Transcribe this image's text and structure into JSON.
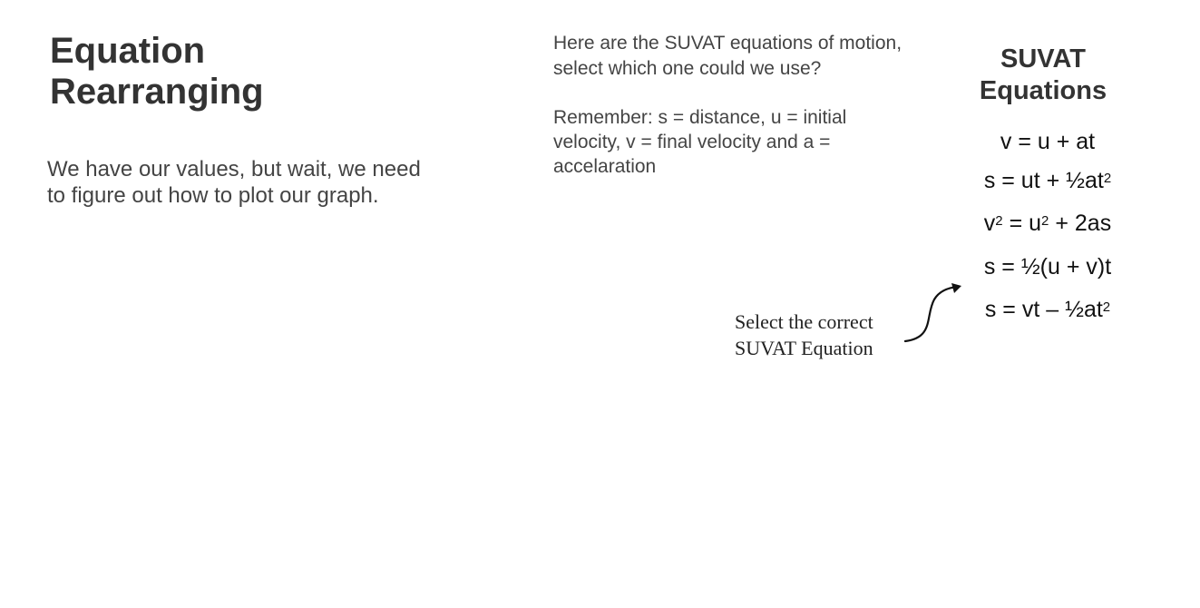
{
  "slide": {
    "title_line1": "Equation",
    "title_line2": "Rearranging",
    "intro_line1": "We have our values, but wait, we need",
    "intro_line2": "to figure out how to plot our graph.",
    "question_line1": "Here are the SUVAT equations of motion,",
    "question_line2": "select which one could we use?",
    "reminder_line1": "Remember: s = distance, u = initial",
    "reminder_line2": "velocity, v = final velocity and a =",
    "reminder_line3": "accelaration",
    "suvat_heading_line1": "SUVAT",
    "suvat_heading_line2": "Equations",
    "equations": [
      {
        "pre": "v = u + at",
        "sup": "",
        "post": ""
      },
      {
        "pre": "s = ut + ½at",
        "sup": "2",
        "post": ""
      },
      {
        "pre": "v",
        "sup": "2",
        "post": " = u",
        "sup2": "2",
        "post2": " + 2as"
      },
      {
        "pre": "s = ½(u + v)t",
        "sup": "",
        "post": ""
      },
      {
        "pre": "s = vt – ½at",
        "sup": "2",
        "post": ""
      }
    ],
    "hint_line1": "Select the correct",
    "hint_line2": "SUVAT Equation",
    "arrow_icon": "curved-arrow-icon"
  }
}
